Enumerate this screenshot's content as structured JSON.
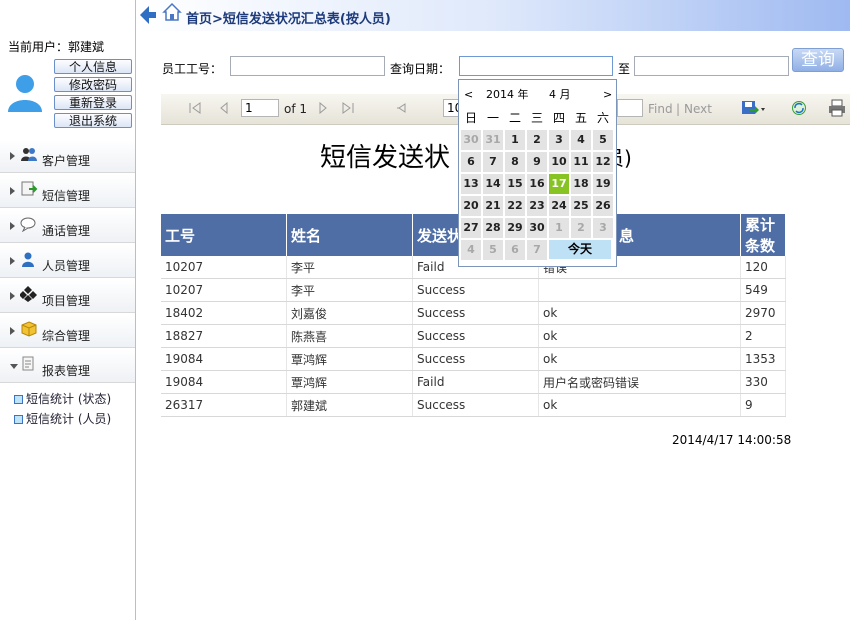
{
  "sidebar": {
    "current_user": "当前用户：郭建斌",
    "buttons": [
      "个人信息",
      "修改密码",
      "重新登录",
      "退出系统"
    ],
    "menus": [
      "客户管理",
      "短信管理",
      "通话管理",
      "人员管理",
      "项目管理",
      "综合管理",
      "报表管理"
    ],
    "subitems": [
      "短信统计 (状态)",
      "短信统计 (人员)"
    ]
  },
  "header": {
    "breadcrumb": "首页>短信发送状况汇总表(按人员)"
  },
  "search": {
    "emp_label": "员工工号：",
    "emp_value": "",
    "date_label": "查询日期：",
    "date_from": "",
    "to_label": "至",
    "date_to": "",
    "query_button": "查询"
  },
  "toolbar": {
    "page_value": "1",
    "page_of": "of 1",
    "zoom_value": "10",
    "find": "Find",
    "sep": "|",
    "next": "Next"
  },
  "report": {
    "title": "短信发送状",
    "title_tail": "员)",
    "columns": [
      "工号",
      "姓名",
      "发送状",
      "息",
      "累计条数"
    ],
    "rows": [
      [
        "10207",
        "李平",
        "Faild",
        "错误",
        "120"
      ],
      [
        "10207",
        "李平",
        "Success",
        "",
        "549"
      ],
      [
        "18402",
        "刘嘉俊",
        "Success",
        "ok",
        "2970"
      ],
      [
        "18827",
        "陈燕喜",
        "Success",
        "ok",
        "2"
      ],
      [
        "19084",
        "覃鸿辉",
        "Success",
        "ok",
        "1353"
      ],
      [
        "19084",
        "覃鸿辉",
        "Faild",
        "用户名或密码错误",
        "330"
      ],
      [
        "26317",
        "郭建斌",
        "Success",
        "ok",
        "9"
      ]
    ],
    "timestamp": "2014/4/17 14:00:58"
  },
  "calendar": {
    "prev": "<",
    "next": ">",
    "year": "2014 年",
    "month": "4 月",
    "weekdays": [
      "日",
      "一",
      "二",
      "三",
      "四",
      "五",
      "六"
    ],
    "weeks": [
      [
        "30",
        "31",
        "1",
        "2",
        "3",
        "4",
        "5"
      ],
      [
        "6",
        "7",
        "8",
        "9",
        "10",
        "11",
        "12"
      ],
      [
        "13",
        "14",
        "15",
        "16",
        "17",
        "18",
        "19"
      ],
      [
        "20",
        "21",
        "22",
        "23",
        "24",
        "25",
        "26"
      ],
      [
        "27",
        "28",
        "29",
        "30",
        "1",
        "2",
        "3"
      ],
      [
        "4",
        "5",
        "6",
        "7"
      ]
    ],
    "selected": "17",
    "today_label": "今天"
  },
  "colors": {
    "header_blue": "#4f6ea6",
    "selected_green": "#86c323",
    "breadcrumb": "#1d3a7a"
  }
}
